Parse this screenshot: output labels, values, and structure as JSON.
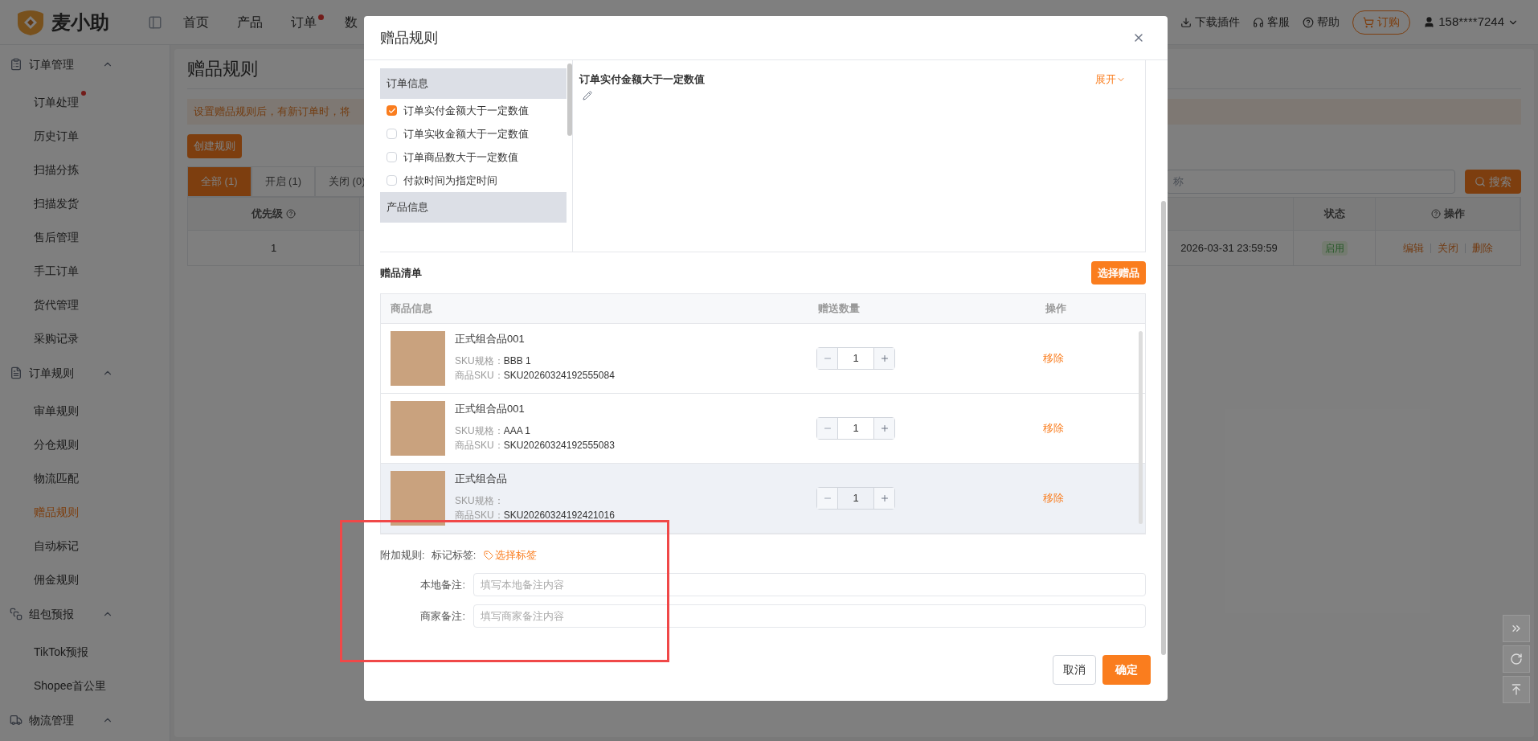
{
  "header": {
    "logo": "麦小助",
    "nav": [
      {
        "label": "首页",
        "badge": false
      },
      {
        "label": "产品",
        "badge": false
      },
      {
        "label": "订单",
        "badge": true
      },
      {
        "label": "数",
        "badge": false
      }
    ],
    "links": [
      {
        "kind": "download",
        "label": "下载插件"
      },
      {
        "kind": "service",
        "label": "客服"
      },
      {
        "kind": "help",
        "label": "帮助"
      }
    ],
    "order_button": "订购",
    "user": "158****7244"
  },
  "sidebar": {
    "groups": [
      {
        "label": "订单管理",
        "expanded": true,
        "children": [
          {
            "label": "订单处理",
            "selected": false,
            "badge": true
          },
          {
            "label": "历史订单",
            "selected": false,
            "badge": false
          },
          {
            "label": "扫描分拣",
            "selected": false,
            "badge": false
          },
          {
            "label": "扫描发货",
            "selected": false,
            "badge": false
          },
          {
            "label": "售后管理",
            "selected": false,
            "badge": false
          },
          {
            "label": "手工订单",
            "selected": false,
            "badge": false
          },
          {
            "label": "货代管理",
            "selected": false,
            "badge": false
          },
          {
            "label": "采购记录",
            "selected": false,
            "badge": false
          }
        ]
      },
      {
        "label": "订单规则",
        "expanded": true,
        "children": [
          {
            "label": "审单规则",
            "selected": false,
            "badge": false
          },
          {
            "label": "分仓规则",
            "selected": false,
            "badge": false
          },
          {
            "label": "物流匹配",
            "selected": false,
            "badge": false
          },
          {
            "label": "赠品规则",
            "selected": true,
            "badge": false
          },
          {
            "label": "自动标记",
            "selected": false,
            "badge": false
          },
          {
            "label": "佣金规则",
            "selected": false,
            "badge": false
          }
        ]
      },
      {
        "label": "组包预报",
        "expanded": true,
        "children": [
          {
            "label": "TikTok预报",
            "selected": false,
            "badge": false
          },
          {
            "label": "Shopee首公里",
            "selected": false,
            "badge": false
          }
        ]
      },
      {
        "label": "物流管理",
        "expanded": true
      }
    ]
  },
  "page": {
    "title": "赠品规则",
    "notice": "设置赠品规则后，有新订单时，将",
    "create_button": "创建规则",
    "tabs": [
      {
        "label": "全部 (1)",
        "selected": true
      },
      {
        "label": "开启 (1)",
        "selected": false
      },
      {
        "label": "关闭 (0)",
        "selected": false
      }
    ],
    "search": {
      "placeholder": "称",
      "button": "搜索"
    },
    "table": {
      "columns": [
        {
          "label": "优先级",
          "help": true
        },
        {
          "label": "状态",
          "help": false
        },
        {
          "label": "操作",
          "help": true
        }
      ],
      "rows": [
        {
          "priority": "1",
          "time": "2026-03-31 23:59:59",
          "status": "启用",
          "actions": [
            "编辑",
            "关闭",
            "删除"
          ]
        }
      ]
    }
  },
  "modal": {
    "title": "赠品规则",
    "conditions": [
      {
        "kind": "group",
        "label": "订单信息"
      },
      {
        "kind": "option",
        "label": "订单实付金额大于一定数值",
        "checked": true
      },
      {
        "kind": "option",
        "label": "订单实收金额大于一定数值",
        "checked": false
      },
      {
        "kind": "option",
        "label": "订单商品数大于一定数值",
        "checked": false
      },
      {
        "kind": "option",
        "label": "付款时间为指定时间",
        "checked": false
      },
      {
        "kind": "group",
        "label": "产品信息"
      }
    ],
    "detail": {
      "title": "订单实付金额大于一定数值",
      "toggle": "展开"
    },
    "gifts": {
      "title": "赠品清单",
      "select_button": "选择赠品",
      "columns": [
        "商品信息",
        "赠送数量",
        "操作"
      ],
      "rows": [
        {
          "name": "正式组合品001",
          "spec_label": "SKU规格：",
          "spec": "BBB 1",
          "sku_label": "商品SKU：",
          "sku": "SKU20260324192555084",
          "qty": "1",
          "action": "移除",
          "hovered": false
        },
        {
          "name": "正式组合品001",
          "spec_label": "SKU规格：",
          "spec": "AAA 1",
          "sku_label": "商品SKU：",
          "sku": "SKU20260324192555083",
          "qty": "1",
          "action": "移除",
          "hovered": false
        },
        {
          "name": "正式组合品",
          "spec_label": "SKU规格：",
          "spec": "",
          "sku_label": "商品SKU：",
          "sku": "SKU20260324192421016",
          "qty": "1",
          "action": "移除",
          "hovered": true
        }
      ]
    },
    "extra": {
      "label": "附加规则:",
      "tag_label": "标记标签:",
      "tag_button": "选择标签",
      "fields": [
        {
          "label": "本地备注:",
          "placeholder": "填写本地备注内容"
        },
        {
          "label": "商家备注:",
          "placeholder": "填写商家备注内容"
        }
      ]
    },
    "cancel": "取消",
    "confirm": "确定"
  }
}
